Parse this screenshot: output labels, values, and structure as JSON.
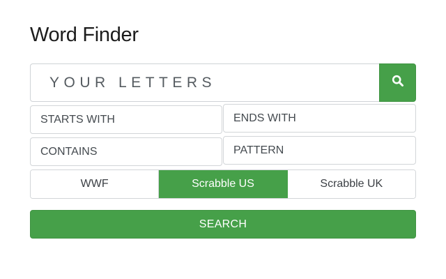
{
  "title": "Word Finder",
  "letters": {
    "placeholder": "YOUR LETTERS",
    "value": ""
  },
  "search_icon": {
    "icon": "search-icon",
    "background": "#46a049"
  },
  "filters": {
    "starts_with": {
      "placeholder": "STARTS WITH",
      "value": ""
    },
    "ends_with": {
      "placeholder": "ENDS WITH",
      "value": ""
    },
    "contains": {
      "placeholder": "CONTAINS",
      "value": ""
    },
    "pattern": {
      "placeholder": "PATTERN",
      "value": ""
    }
  },
  "dictionaries": [
    {
      "label": "WWF",
      "active": false
    },
    {
      "label": "Scrabble US",
      "active": true
    },
    {
      "label": "Scrabble UK",
      "active": false
    }
  ],
  "search_button": {
    "label": "SEARCH"
  },
  "colors": {
    "accent": "#46a049",
    "border": "#d2d5d8",
    "text": "#1c1c1c"
  }
}
